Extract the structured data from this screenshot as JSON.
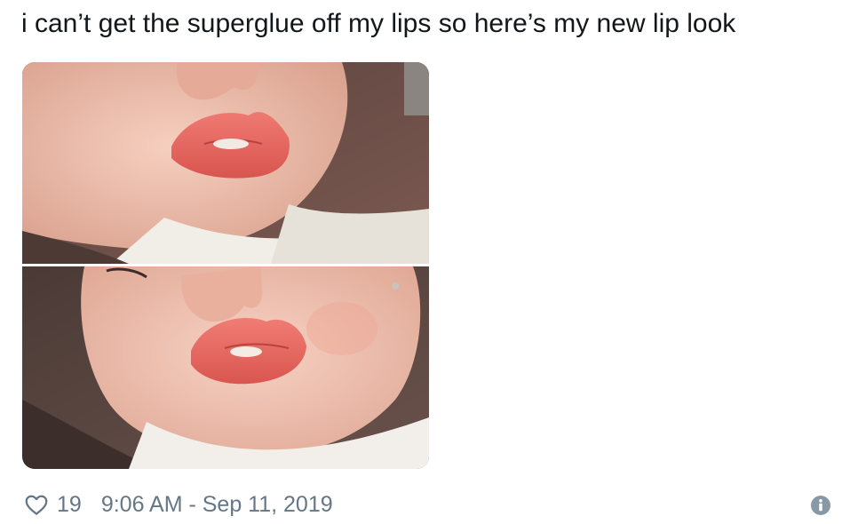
{
  "tweet": {
    "text": "i can’t get the superglue off my lips so here’s my new lip look",
    "like_count": "19",
    "timestamp": "9:06 AM - Sep 11, 2019"
  },
  "icons": {
    "like": "heart-outline-icon",
    "info": "info-circle-icon"
  },
  "colors": {
    "text": "#14171a",
    "secondary": "#657786",
    "lip": "#e86e68",
    "skin": "#f0c3b1",
    "background_wall": "#6b4e49"
  }
}
